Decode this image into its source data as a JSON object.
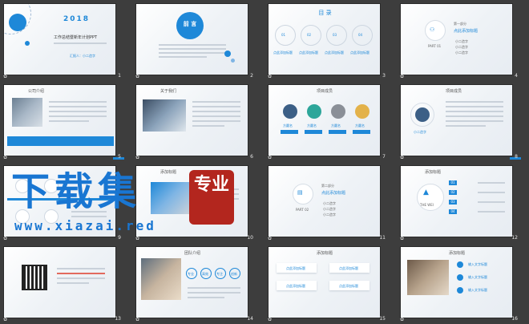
{
  "slides": [
    {
      "num": "1",
      "year": "2018",
      "title": "工作总结暨新年计划PPT",
      "subtitle": "汇报人：小二造字"
    },
    {
      "num": "2",
      "title": "前 言"
    },
    {
      "num": "3",
      "title": "目 录",
      "items": [
        "01",
        "02",
        "03",
        "04"
      ],
      "item_label": "点此添加标题"
    },
    {
      "num": "4",
      "part": "第一部分",
      "part_title": "点此添加标题",
      "part_sub": "PART 01",
      "bullets": [
        "小二造字",
        "小二造字",
        "小二造字"
      ]
    },
    {
      "num": "5",
      "title": "公司介绍"
    },
    {
      "num": "6",
      "title": "关于我们"
    },
    {
      "num": "7",
      "title": "项目成员",
      "names": [
        "方圆名",
        "方圆名",
        "方圆名",
        "方圆名"
      ]
    },
    {
      "num": "8",
      "title": "项目成员",
      "name": "小二造字"
    },
    {
      "num": "9",
      "title": ""
    },
    {
      "num": "10",
      "title": "添加标题"
    },
    {
      "num": "11",
      "part": "第二部分",
      "part_title": "点此添加标题",
      "part_sub": "PART 02",
      "bullets": [
        "小二造字",
        "小二造字",
        "小二造字"
      ]
    },
    {
      "num": "12",
      "title": "添加标题",
      "center": "THE WEI",
      "steps": [
        "01",
        "02",
        "03",
        "04"
      ]
    },
    {
      "num": "13",
      "title": ""
    },
    {
      "num": "14",
      "title": "团队介绍",
      "tags": [
        "专业",
        "高效",
        "专注",
        "创新"
      ]
    },
    {
      "num": "15",
      "title": "添加标题",
      "label": "点此添加标题"
    },
    {
      "num": "16",
      "title": "添加标题",
      "label": "输入文字标题"
    }
  ],
  "watermark": {
    "big": "下载集",
    "seal": "专业",
    "url": "www.xiazai.red"
  },
  "colors": {
    "accent": "#1e88d8",
    "background": "#3d3d3d",
    "seal": "#b3261e"
  }
}
